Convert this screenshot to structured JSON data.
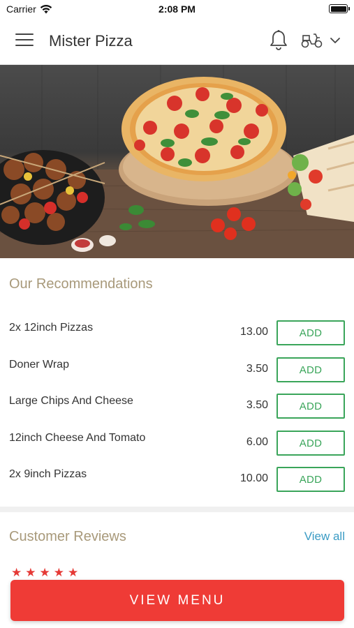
{
  "status_bar": {
    "carrier": "Carrier",
    "time": "2:08 PM"
  },
  "header": {
    "title": "Mister Pizza",
    "icons": [
      "menu-icon",
      "bell-icon",
      "scooter-icon",
      "chevron-down-icon"
    ]
  },
  "hero": {
    "image": "pizza-kebab-wrap-banner"
  },
  "recommendations": {
    "title": "Our Recommendations",
    "items": [
      {
        "name": "2x 12inch Pizzas",
        "price": "13.00",
        "action": "ADD"
      },
      {
        "name": "Doner Wrap",
        "price": "3.50",
        "action": "ADD"
      },
      {
        "name": "Large Chips And Cheese",
        "price": "3.50",
        "action": "ADD"
      },
      {
        "name": "12inch Cheese And Tomato",
        "price": "6.00",
        "action": "ADD"
      },
      {
        "name": "2x 9inch Pizzas",
        "price": "10.00",
        "action": "ADD"
      }
    ]
  },
  "reviews": {
    "title": "Customer Reviews",
    "view_all": "View all",
    "stars": [
      "★",
      "★",
      "★",
      "★",
      "★"
    ]
  },
  "cta": {
    "view_menu": "VIEW MENU"
  },
  "colors": {
    "accent_red": "#ef3b36",
    "add_green": "#3aa55a",
    "section_title": "#a8997a",
    "link_blue": "#3a9bc4"
  }
}
